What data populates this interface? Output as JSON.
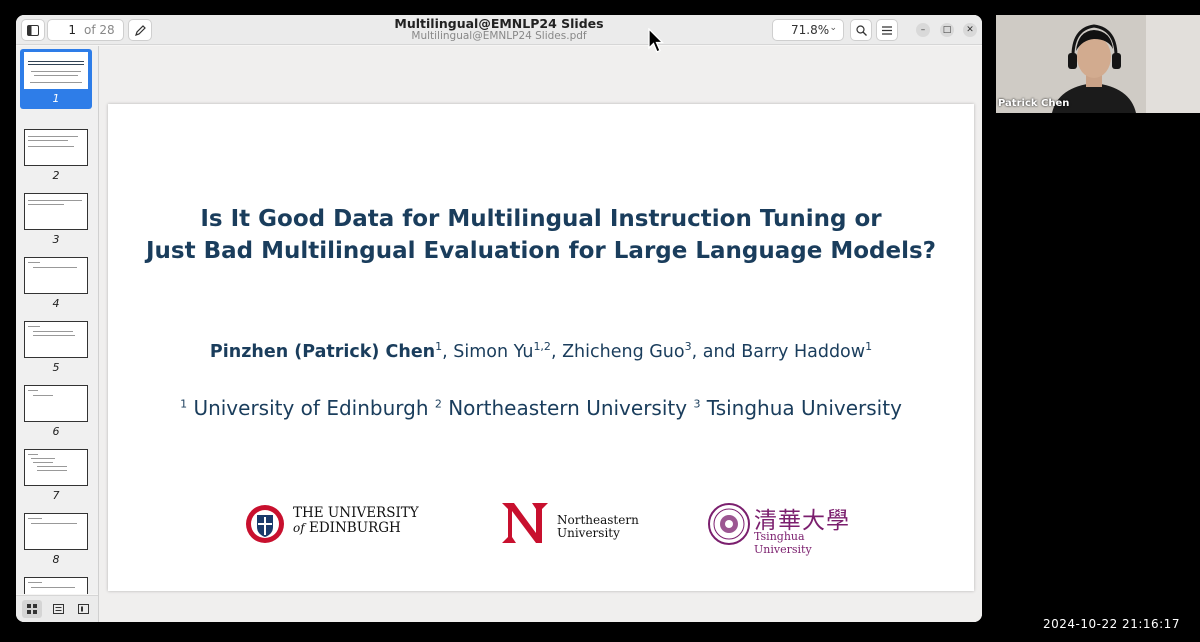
{
  "window": {
    "title": "Multilingual@EMNLP24 Slides",
    "filename": "Multilingual@EMNLP24 Slides.pdf",
    "current_page": "1",
    "page_total": "of 28",
    "zoom": "71.8%"
  },
  "thumbnails": [
    "1",
    "2",
    "3",
    "4",
    "5",
    "6",
    "7",
    "8"
  ],
  "slide": {
    "title_line1": "Is It Good Data for Multilingual Instruction Tuning or",
    "title_line2": "Just Bad Multilingual Evaluation for Large Language Models?",
    "author1": "Pinzhen (Patrick) Chen",
    "author1_sup": "1",
    "author2": ", Simon Yu",
    "author2_sup": "1,2",
    "author3": ", Zhicheng Guo",
    "author3_sup": "3",
    "author4": ", and Barry Haddow",
    "author4_sup": "1",
    "affil1_sup": "1",
    "affil1": "University of Edinburgh",
    "affil2_sup": "2",
    "affil2": "Northeastern University",
    "affil3_sup": "3",
    "affil3": "Tsinghua University",
    "logos": {
      "edinburgh_line1": "THE UNIVERSITY",
      "edinburgh_of": "of",
      "edinburgh_line2": "EDINBURGH",
      "northeastern_line1": "Northeastern",
      "northeastern_line2": "University",
      "tsinghua_cn": "清華大學",
      "tsinghua_en": "Tsinghua University"
    }
  },
  "webcam": {
    "name": "Patrick Chen"
  },
  "timestamp": "2024-10-22  21:16:17",
  "colors": {
    "accent": "#2e7de8",
    "slide_text": "#1a3d5c",
    "northeastern_red": "#c8102e",
    "tsinghua_purple": "#7b1f6e"
  }
}
